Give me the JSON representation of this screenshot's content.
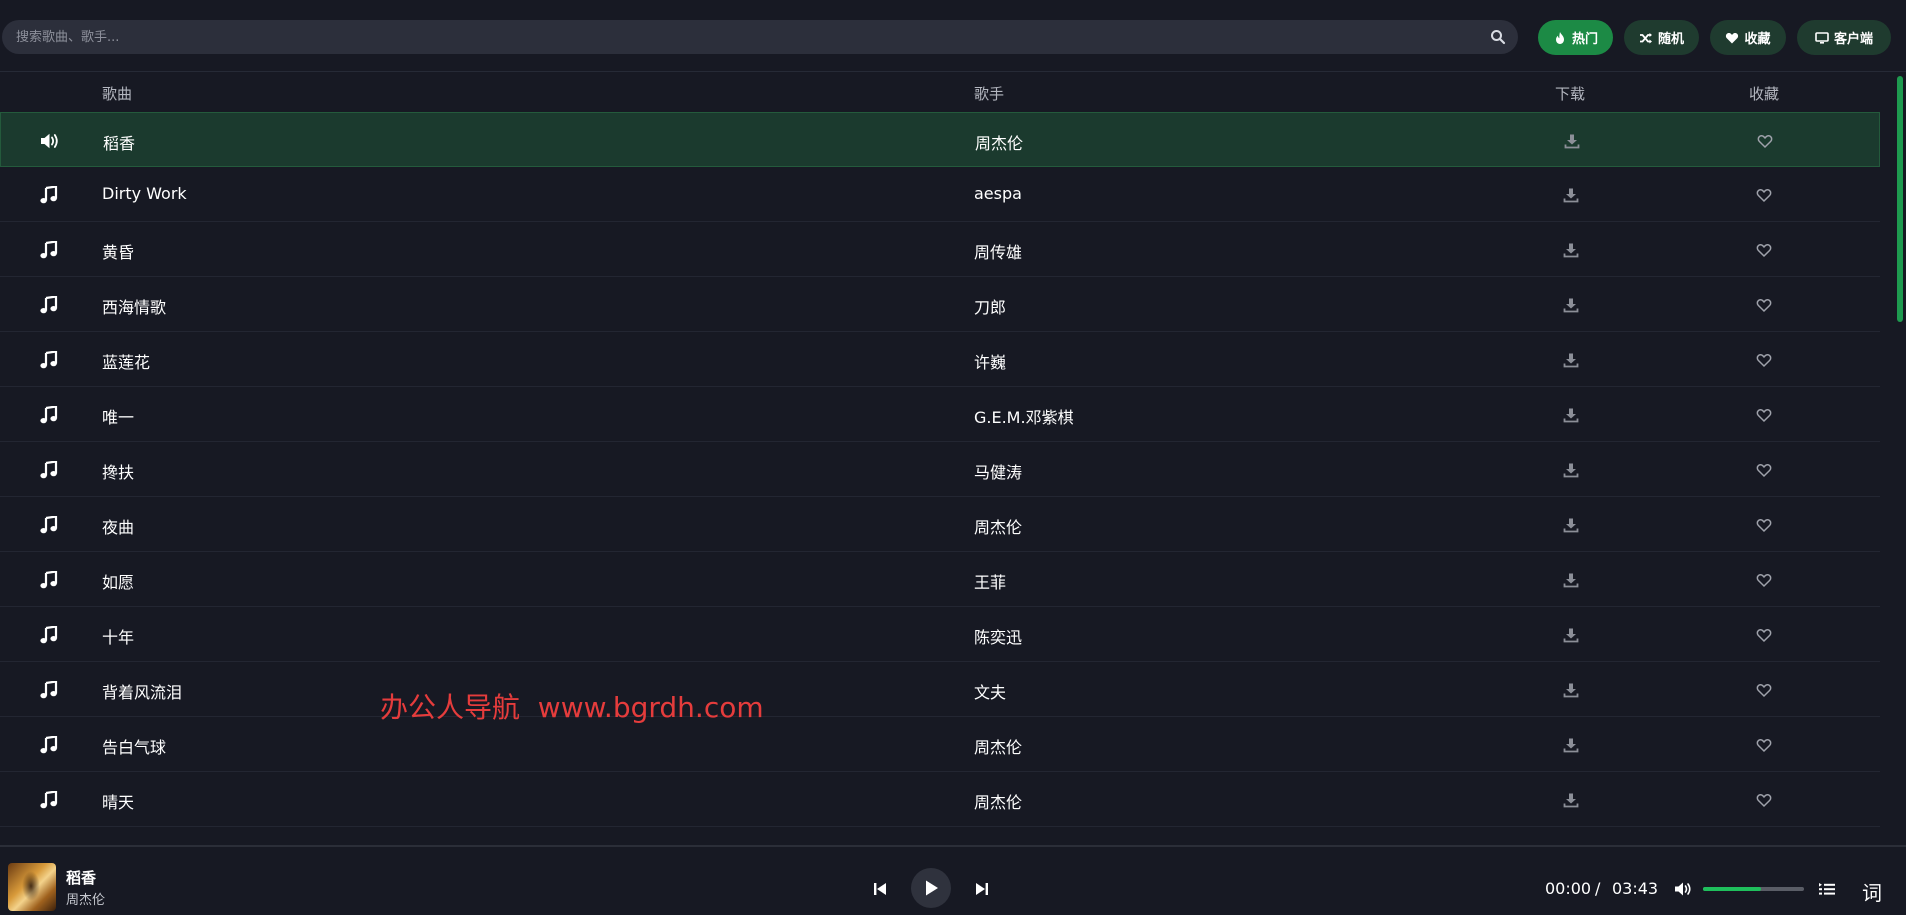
{
  "search": {
    "placeholder": "搜索歌曲、歌手..."
  },
  "toolbar": {
    "buttons": [
      {
        "label": "热门",
        "icon": "fire-icon",
        "active": true
      },
      {
        "label": "随机",
        "icon": "shuffle-icon",
        "active": false
      },
      {
        "label": "收藏",
        "icon": "heart-icon",
        "active": false
      },
      {
        "label": "客户端",
        "icon": "monitor-icon",
        "active": false
      }
    ]
  },
  "table": {
    "headers": {
      "song": "歌曲",
      "artist": "歌手",
      "download": "下载",
      "favorite": "收藏"
    },
    "rows": [
      {
        "title": "稻香",
        "artist": "周杰伦",
        "playing": true
      },
      {
        "title": "Dirty Work",
        "artist": "aespa",
        "playing": false
      },
      {
        "title": "黄昏",
        "artist": "周传雄",
        "playing": false
      },
      {
        "title": "西海情歌",
        "artist": "刀郎",
        "playing": false
      },
      {
        "title": "蓝莲花",
        "artist": "许巍",
        "playing": false
      },
      {
        "title": "唯一",
        "artist": "G.E.M.邓紫棋",
        "playing": false
      },
      {
        "title": "搀扶",
        "artist": "马健涛",
        "playing": false
      },
      {
        "title": "夜曲",
        "artist": "周杰伦",
        "playing": false
      },
      {
        "title": "如愿",
        "artist": "王菲",
        "playing": false
      },
      {
        "title": "十年",
        "artist": "陈奕迅",
        "playing": false
      },
      {
        "title": "背着风流泪",
        "artist": "文夫",
        "playing": false
      },
      {
        "title": "告白气球",
        "artist": "周杰伦",
        "playing": false
      },
      {
        "title": "晴天",
        "artist": "周杰伦",
        "playing": false
      }
    ]
  },
  "watermark": "办公人导航  www.bgrdh.com",
  "player": {
    "title": "稻香",
    "artist": "周杰伦",
    "current_time": "00:00",
    "separator": "/",
    "duration": "03:43",
    "volume": 0.57,
    "lyric_label": "词"
  },
  "colors": {
    "accent": "#1c8a45",
    "button_bg": "#1f3b2f",
    "playing_row": "#1b3a2e",
    "background": "#171923",
    "watermark": "#e53c3c"
  }
}
